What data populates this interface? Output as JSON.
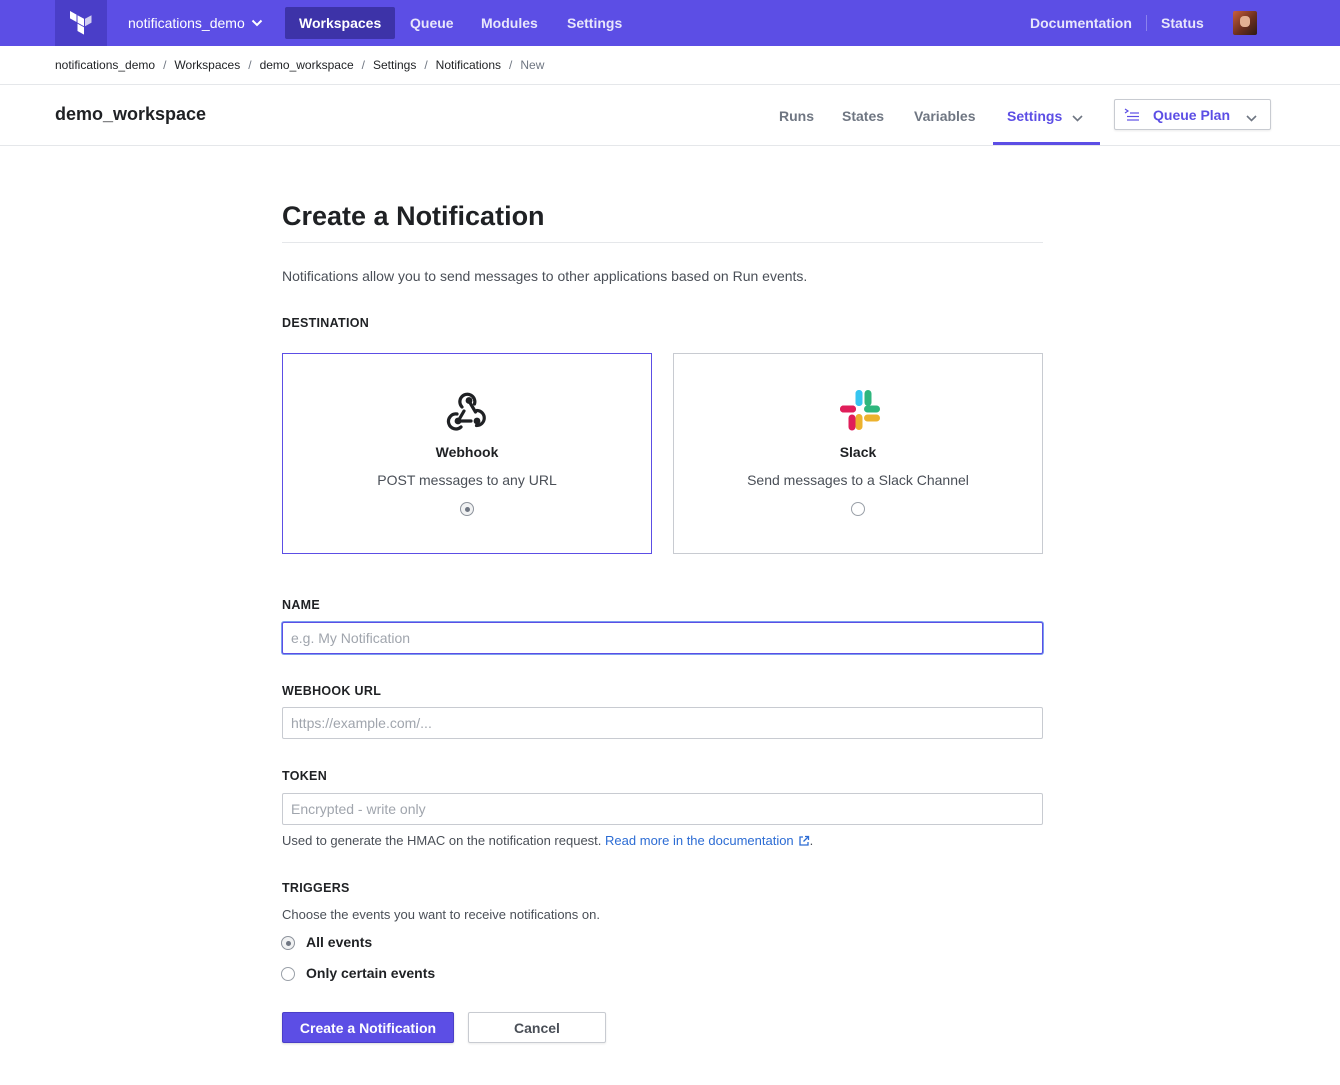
{
  "topnav": {
    "org": "notifications_demo",
    "items": [
      {
        "label": "Workspaces",
        "active": true
      },
      {
        "label": "Queue",
        "active": false
      },
      {
        "label": "Modules",
        "active": false
      },
      {
        "label": "Settings",
        "active": false
      }
    ],
    "right": {
      "documentation": "Documentation",
      "status": "Status"
    }
  },
  "breadcrumb": [
    "notifications_demo",
    "Workspaces",
    "demo_workspace",
    "Settings",
    "Notifications",
    "New"
  ],
  "workspace": {
    "title": "demo_workspace",
    "tabs": [
      "Runs",
      "States",
      "Variables",
      "Settings"
    ],
    "active_tab": "Settings",
    "queue_button": "Queue Plan"
  },
  "form": {
    "title": "Create a Notification",
    "intro": "Notifications allow you to send messages to other applications based on Run events.",
    "destination_label": "DESTINATION",
    "destinations": [
      {
        "name": "Webhook",
        "description": "POST messages to any URL",
        "selected": true,
        "icon": "webhook-icon"
      },
      {
        "name": "Slack",
        "description": "Send messages to a Slack Channel",
        "selected": false,
        "icon": "slack-icon"
      }
    ],
    "name": {
      "label": "NAME",
      "placeholder": "e.g. My Notification",
      "value": ""
    },
    "webhook_url": {
      "label": "WEBHOOK URL",
      "placeholder": "https://example.com/...",
      "value": ""
    },
    "token": {
      "label": "TOKEN",
      "placeholder": "Encrypted - write only",
      "value": "",
      "help_text": "Used to generate the HMAC on the notification request.",
      "help_link": "Read more in the documentation",
      "help_suffix": "."
    },
    "triggers": {
      "label": "TRIGGERS",
      "description": "Choose the events you want to receive notifications on.",
      "options": [
        {
          "label": "All events",
          "selected": true
        },
        {
          "label": "Only certain events",
          "selected": false
        }
      ]
    },
    "submit": "Create a Notification",
    "cancel": "Cancel"
  },
  "colors": {
    "brand": "#5c4ee5",
    "brand_dark": "#4a3ec8",
    "link": "#2c6cd4",
    "slack_blue": "#36c5f0",
    "slack_green": "#2eb67d",
    "slack_yellow": "#ecb22e",
    "slack_red": "#e01e5a"
  }
}
